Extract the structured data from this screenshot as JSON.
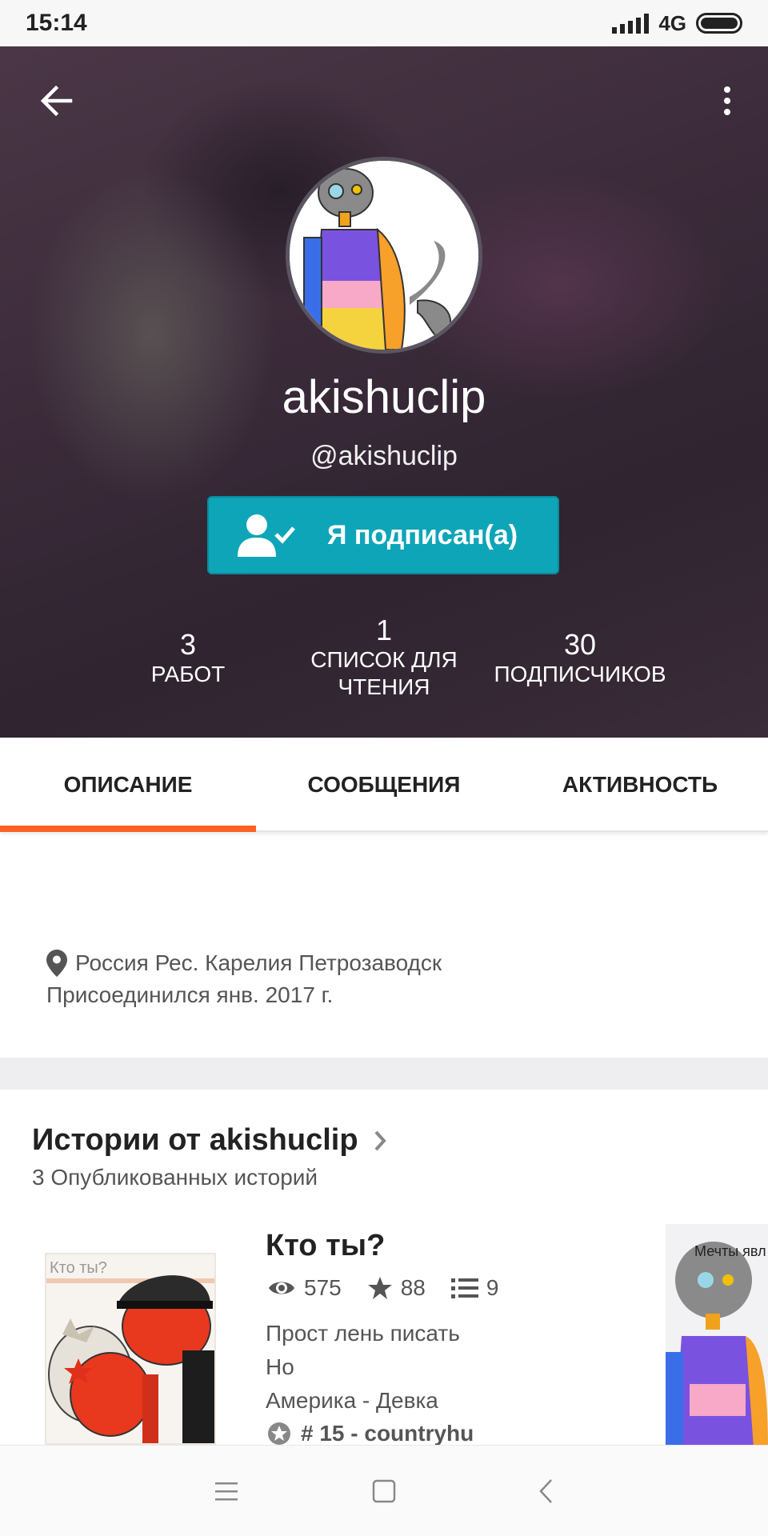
{
  "status_bar": {
    "time": "15:14",
    "network": "4G"
  },
  "profile": {
    "username": "akishuclip",
    "handle": "@akishuclip",
    "follow_label": "Я подписан(а)",
    "follow_color": "#0ea5b8"
  },
  "stats": [
    {
      "value": "3",
      "label": "РАБОТ"
    },
    {
      "value": "1",
      "label": "СПИСОК ДЛЯ ЧТЕНИЯ"
    },
    {
      "value": "30",
      "label": "ПОДПИСЧИКОВ"
    }
  ],
  "tabs": [
    {
      "label": "ОПИСАНИЕ",
      "active": true
    },
    {
      "label": "СООБЩЕНИЯ",
      "active": false
    },
    {
      "label": "АКТИВНОСТЬ",
      "active": false
    }
  ],
  "accent_color": "#ff6122",
  "about": {
    "location": "Россия Рес. Карелия Петрозаводск",
    "joined": "Присоединился янв. 2017 г."
  },
  "stories_section": {
    "title": "Истории от akishuclip",
    "subtitle": "3 Опубликованных историй"
  },
  "story": {
    "cover_text": "Кто ты?",
    "title": "Кто ты?",
    "views": "575",
    "votes": "88",
    "parts": "9",
    "description_lines": [
      "Прост лень писать",
      "Но",
      "Америка - Девка"
    ],
    "rank": "# 15 - countryhu"
  },
  "second_story": {
    "cover_text": "Мечты явл"
  }
}
